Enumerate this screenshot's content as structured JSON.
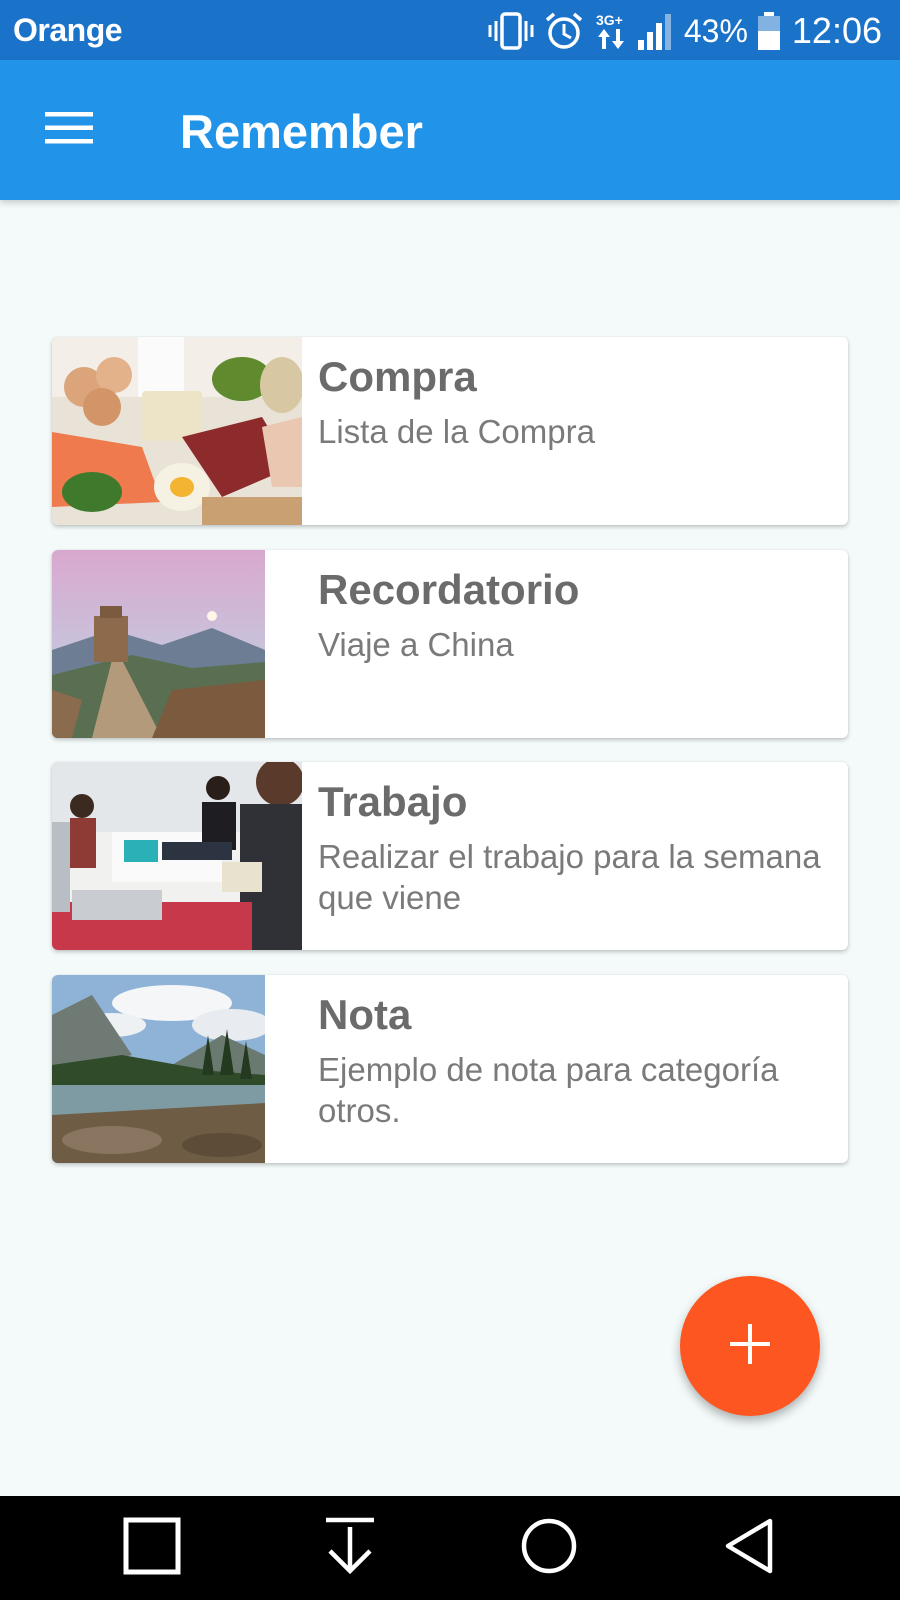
{
  "status_bar": {
    "carrier": "Orange",
    "network": "3G+",
    "battery": "43%",
    "time": "12:06",
    "icons": [
      "vibrate-icon",
      "alarm-icon",
      "network-3g-icon",
      "signal-icon",
      "battery-icon"
    ]
  },
  "app_bar": {
    "title": "Remember",
    "menu_icon": "hamburger-menu-icon"
  },
  "notes": [
    {
      "title": "Compra",
      "text": "Lista de la Compra",
      "image": "groceries-photo"
    },
    {
      "title": "Recordatorio",
      "text": "Viaje a China",
      "image": "great-wall-photo"
    },
    {
      "title": "Trabajo",
      "text": "Realizar el trabajo para la semana que viene",
      "image": "office-work-photo"
    },
    {
      "title": "Nota",
      "text": "Ejemplo de nota para categoría otros.",
      "image": "mountain-lake-photo"
    }
  ],
  "fab": {
    "icon": "plus-icon",
    "color": "#fe5620"
  },
  "nav_bar": {
    "buttons": [
      "recent-apps-icon",
      "notification-pull-icon",
      "home-icon",
      "back-icon"
    ]
  },
  "colors": {
    "status_bar": "#1a73c8",
    "app_bar": "#2194e9",
    "background": "#f4fafa",
    "accent": "#fe5620"
  }
}
